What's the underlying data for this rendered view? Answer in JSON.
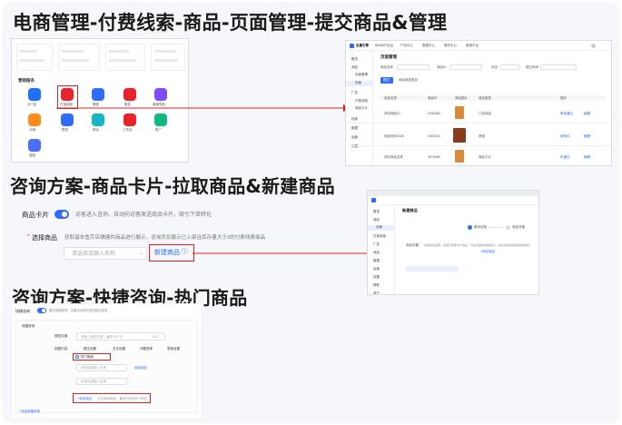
{
  "headings": {
    "h1": "电商管理-付费线索-商品-页面管理-提交商品&管理",
    "h2": "咨询方案-商品卡片-拉取商品&新建商品",
    "h3": "咨询方案-快捷咨询-热门商品"
  },
  "apps": {
    "section_label": "营销服务",
    "items": [
      "分门店",
      "付费线索",
      "橙推",
      "裂变",
      "营销导航",
      "分销",
      "群发",
      "联合",
      "工作台",
      "推广",
      "智能"
    ]
  },
  "product_admin": {
    "brand": "巨量引擎",
    "brand_sub": "Bbb商户后台",
    "nav": [
      "产品中心",
      "数据中心",
      "服务中心",
      "营销平台"
    ],
    "page_title": "页面管理",
    "filter_labels": [
      "商品名称",
      "商品ID",
      "状态",
      "提交时间"
    ],
    "add_button": "提交",
    "add_button2": "添加商品类目",
    "table_headers": [
      "商品名称",
      "商品ID",
      "商品图片",
      "商品类型",
      "状态",
      "操作"
    ],
    "rows": [
      {
        "name": "测试商品01",
        "id": "2333455",
        "type": "门店商品",
        "status": "审核通过",
        "op": "编辑"
      },
      {
        "name": "商品测试0428",
        "id": "3453234",
        "type": "其他",
        "status": "审核中",
        "op": "编辑"
      },
      {
        "name": "测试商品名称",
        "id": "3678459",
        "type": "商品卡片",
        "status": "未通过",
        "op": "编辑"
      }
    ],
    "sidebar": [
      "概览",
      "商品",
      "页面管理",
      "页面",
      "广告",
      "付费线索",
      "商品卡片",
      "线索",
      "数据",
      "运营",
      "设置"
    ]
  },
  "card_setting": {
    "label": "商品卡片",
    "desc": "访客进入咨询、自动向访客发送商品卡片，吸引下单转化",
    "select_label": "选择商品",
    "select_desc": "获取基本鱼芹店铺建的商品进行展示，咨询页仅展示已上架且库存量大于0的付费线索商品",
    "select_placeholder": "请选择或输入名称",
    "create_button": "新建商品"
  },
  "new_product": {
    "title": "新建商品",
    "steps": [
      "基本信息",
      "商品详情"
    ],
    "field": "商品设置",
    "field_desc": "请新建商品库，请自行选择卡片信息，可在内容中添加信息，请先创建完成后再选择信息",
    "link": "+添加商品",
    "sidebar": [
      "概览",
      "商品",
      "页面",
      "付费线索",
      "广告",
      "商品",
      "数据",
      "运营",
      "设置",
      "帮助",
      "资产"
    ]
  },
  "quick": {
    "toggle_label": "快捷咨询",
    "toggle_desc": "展示快捷咨询，访客点击即可发送相应信息",
    "section": "快捷咨询",
    "text_label": "按钮文案",
    "text_placeholder": "请输入按钮文案，最多16个字",
    "text_count": "0/16",
    "content_label": "回复内容",
    "tabs": [
      "图文设置",
      "文字设置",
      "问题咨询",
      "表单设置"
    ],
    "hot_radio": "热门商品",
    "select1": "请选择或输入名称",
    "select2": "请选择或输入名称",
    "add_link": "添加商品",
    "add_bar_link": "+添加商品",
    "add_bar_desc": "点击添加商品，最多可添加5个商品",
    "more_link": "+添加快捷咨询"
  }
}
